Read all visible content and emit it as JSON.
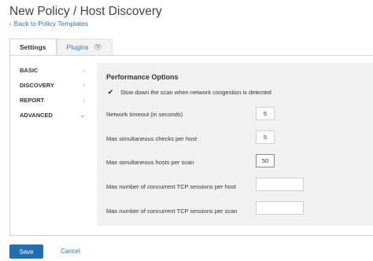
{
  "header": {
    "title": "New Policy / Host Discovery",
    "back_link": "Back to Policy Templates"
  },
  "tabs": [
    {
      "label": "Settings",
      "active": true
    },
    {
      "label": "Plugins",
      "active": false,
      "icon": "eye-icon"
    }
  ],
  "sidebar": {
    "items": [
      {
        "label": "BASIC",
        "icon": "chevron-right-icon"
      },
      {
        "label": "DISCOVERY",
        "icon": "chevron-right-icon"
      },
      {
        "label": "REPORT",
        "icon": "chevron-right-icon"
      },
      {
        "label": "ADVANCED",
        "icon": "chevron-down-icon",
        "selected": true
      }
    ]
  },
  "performance": {
    "title": "Performance Options",
    "slow_down": {
      "label": "Slow down the scan when network congestion is detected",
      "checked": true
    },
    "fields": [
      {
        "label": "Network timeout (in seconds)",
        "value": "5"
      },
      {
        "label": "Max simultaneous checks per host",
        "value": "5"
      },
      {
        "label": "Max simultaneous hosts per scan",
        "value": "50"
      },
      {
        "label": "Max number of concurrent TCP sessions per host",
        "value": ""
      },
      {
        "label": "Max number of concurrent TCP sessions per scan",
        "value": ""
      }
    ]
  },
  "footer": {
    "save": "Save",
    "cancel": "Cancel"
  },
  "colors": {
    "accent": "#1f6fb5",
    "link": "#2a78c5",
    "panel_bg": "#f1f1f1"
  }
}
